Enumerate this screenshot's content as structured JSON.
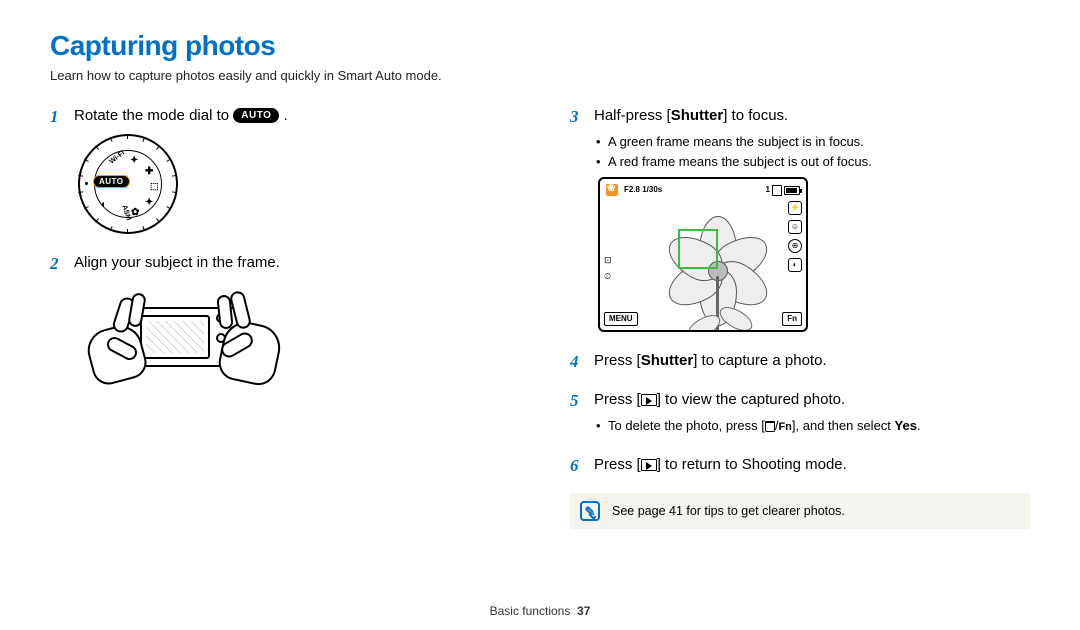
{
  "title": "Capturing photos",
  "subtitle": "Learn how to capture photos easily and quickly in Smart Auto mode.",
  "left": {
    "step1": {
      "num": "1",
      "pre": "Rotate the mode dial to ",
      "pill": "AUTO",
      "post": " ."
    },
    "dial": {
      "auto": "AUTO",
      "wifi": "Wi-Fi",
      "asm": "ASM"
    },
    "step2": {
      "num": "2",
      "text": "Align your subject in the frame."
    }
  },
  "right": {
    "step3": {
      "num": "3",
      "pre": "Half-press [",
      "bold": "Shutter",
      "post": "] to focus.",
      "bullets": [
        "A green frame means the subject is in focus.",
        "A red frame means the subject is out of focus."
      ]
    },
    "lcd": {
      "exposure": "F2.8  1/30s",
      "count": "1",
      "menu": "MENU",
      "fn": "Fn"
    },
    "step4": {
      "num": "4",
      "pre": "Press [",
      "bold": "Shutter",
      "post": "] to capture a photo."
    },
    "step5": {
      "num": "5",
      "pre": "Press [",
      "post": "] to view the captured photo.",
      "bullet_pre": "To delete the photo, press [",
      "bullet_mid": "/",
      "bullet_fn": "Fn",
      "bullet_post": "], and then select ",
      "bullet_bold": "Yes",
      "bullet_end": "."
    },
    "step6": {
      "num": "6",
      "pre": "Press [",
      "post": "] to return to Shooting mode."
    },
    "tip": "See page 41 for tips to get clearer photos."
  },
  "footer": {
    "section": "Basic functions",
    "page": "37"
  }
}
